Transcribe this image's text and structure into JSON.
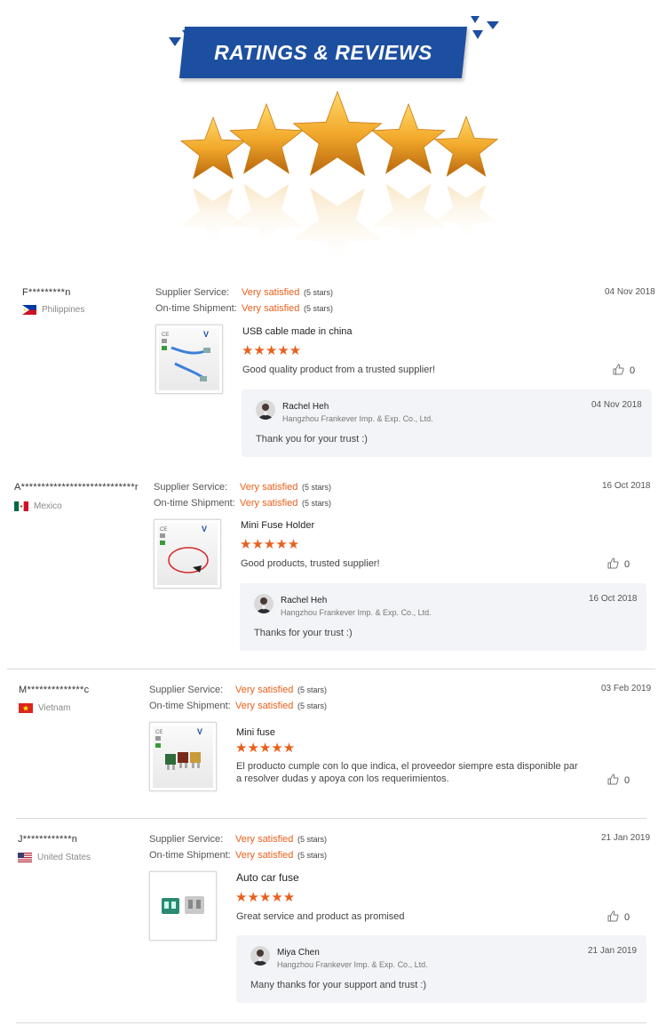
{
  "header": {
    "title": "RATINGS & REVIEWS"
  },
  "labels": {
    "supplier_service": "Supplier Service:",
    "on_time_shipment": "On-time Shipment:"
  },
  "colors": {
    "accent": "#e8601c",
    "banner": "#1d4fa0",
    "star_gold": "#f2a92b"
  },
  "reviews": [
    {
      "user": "F*********n",
      "country": "Philippines",
      "flag": "philippines-flag",
      "supplier_value": "Very satisfied",
      "supplier_stars": "(5 stars)",
      "shipment_value": "Very satisfied",
      "shipment_stars": "(5 stars)",
      "date": "04 Nov 2018",
      "product_title": "USB cable made in china",
      "rating": 5,
      "comment": "Good quality product from a trusted supplier!",
      "likes": "0",
      "reply": {
        "name": "Rachel Heh",
        "company": "Hangzhou Frankever Imp. & Exp. Co., Ltd.",
        "date": "04 Nov 2018",
        "text": "Thank you for your trust :)"
      }
    },
    {
      "user": "A****************************r",
      "country": "Mexico",
      "flag": "mexico-flag",
      "supplier_value": "Very satisfied",
      "supplier_stars": "(5 stars)",
      "shipment_value": "Very satisfied",
      "shipment_stars": "(5 stars)",
      "date": "16 Oct 2018",
      "product_title": "Mini Fuse Holder",
      "rating": 5,
      "comment": "Good products, trusted supplier!",
      "likes": "0",
      "reply": {
        "name": "Rachel Heh",
        "company": "Hangzhou Frankever Imp. & Exp. Co., Ltd.",
        "date": "16 Oct 2018",
        "text": "Thanks for your trust :)"
      }
    },
    {
      "user": "M**************c",
      "country": "Vietnam",
      "flag": "vietnam-flag",
      "supplier_value": "Very satisfied",
      "supplier_stars": "(5 stars)",
      "shipment_value": "Very satisfied",
      "shipment_stars": "(5 stars)",
      "date": "03 Feb 2019",
      "product_title": "Mini fuse",
      "rating": 5,
      "comment_line1": "El producto cumple con lo que indica, el proveedor siempre esta disponible par",
      "comment_line2": "a resolver dudas y apoya con los requerimientos.",
      "likes": "0"
    },
    {
      "user": "J************n",
      "country": "United States",
      "flag": "us-flag",
      "supplier_value": "Very satisfied",
      "supplier_stars": "(5 stars)",
      "shipment_value": "Very satisfied",
      "shipment_stars": "(5 stars)",
      "date": "21 Jan 2019",
      "product_title": "Auto car fuse",
      "rating": 5,
      "comment": "Great service and product as promised",
      "likes": "0",
      "reply": {
        "name": "Miya Chen",
        "company": "Hangzhou Frankever Imp. & Exp. Co., Ltd.",
        "date": "21 Jan 2019",
        "text": "Many thanks for your support and trust :)"
      }
    }
  ]
}
